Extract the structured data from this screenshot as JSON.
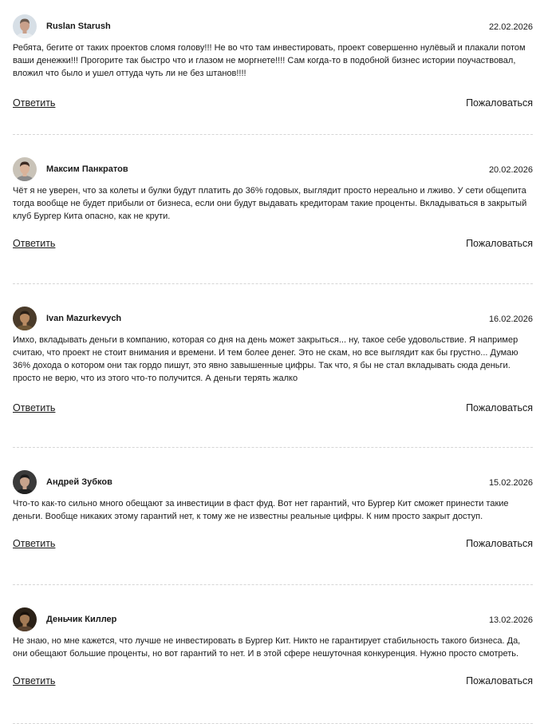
{
  "comments": [
    {
      "author": "Ruslan Starush",
      "date": "22.02.2026",
      "avatar_icon": "user-avatar-photo",
      "avatar_colors": {
        "bg": "#d7dfe6",
        "skin": "#c9a08a",
        "hair": "#6b5a4e",
        "shirt": "#e8ecef"
      },
      "text": "Ребята, бегите от таких проектов сломя голову!!! Не во что там инвестировать, проект совершенно нулёвый и плакали потом ваши денежки!!! Прогорите так быстро что и глазом не моргнете!!!! Сам когда-то в подобной бизнес истории поучаствовал, вложил что было и ушел оттуда чуть ли не без штанов!!!!",
      "reply": "Ответить",
      "report": "Пожаловаться"
    },
    {
      "author": "Максим Панкратов",
      "date": "20.02.2026",
      "avatar_icon": "user-avatar-photo",
      "avatar_colors": {
        "bg": "#c9c3b8",
        "skin": "#d9b39a",
        "hair": "#3b2a22",
        "shirt": "#8a8a8a"
      },
      "text": "Чёт я не уверен, что за колеты и булки будут платить до 36% годовых, выглядит просто нереально и лживо. У сети общепита тогда вообще не будет прибыли от бизнеса, если они будут выдавать кредиторам такие проценты. Вкладываться в закрытый клуб Бургер Кита опасно, как не крути.",
      "reply": "Ответить",
      "report": "Пожаловаться"
    },
    {
      "author": "Ivan Mazurkevych",
      "date": "16.02.2026",
      "avatar_icon": "user-avatar-photo",
      "avatar_colors": {
        "bg": "#4a3b2a",
        "skin": "#b88a62",
        "hair": "#2a1f16",
        "shirt": "#6e5636"
      },
      "text": "Имхо, вкладывать деньги в компанию, которая со дня на день может закрыться... ну, такое себе удовольствие. Я например считаю, что проект не стоит внимания и времени. И тем более денег. Это не скам, но все выглядит как бы грустно... Думаю 36% дохода о котором они так гордо пишут, это явно завышенные цифры. Так что, я бы не стал вкладывать сюда деньги. просто не верю, что из этого что-то получится. А деньги терять жалко",
      "reply": "Ответить",
      "report": "Пожаловаться"
    },
    {
      "author": "Андрей Зубков",
      "date": "15.02.2026",
      "avatar_icon": "user-avatar-photo",
      "avatar_colors": {
        "bg": "#3a3a3a",
        "skin": "#c7a38c",
        "hair": "#1b1b1b",
        "shirt": "#222222"
      },
      "text": "Что-то как-то сильно много обещают за инвестиции в фаст фуд. Вот нет гарантий, что Бургер Кит сможет принести такие деньги. Вообще никаких этому гарантий нет, к тому же не известны реальные цифры. К ним просто закрыт доступ.",
      "reply": "Ответить",
      "report": "Пожаловаться"
    },
    {
      "author": "Деньчик Киллер",
      "date": "13.02.2026",
      "avatar_icon": "user-avatar-photo",
      "avatar_colors": {
        "bg": "#2b2117",
        "skin": "#a37a55",
        "hair": "#1a120c",
        "shirt": "#5a4330"
      },
      "text": "Не знаю, но мне кажется, что лучше не инвестировать в Бургер Кит. Никто не гарантирует стабильность такого бизнеса. Да, они обещают большие проценты, но вот гарантий то нет. И в этой сфере нешуточная конкуренция. Нужно просто смотреть.",
      "reply": "Ответить",
      "report": "Пожаловаться"
    }
  ]
}
